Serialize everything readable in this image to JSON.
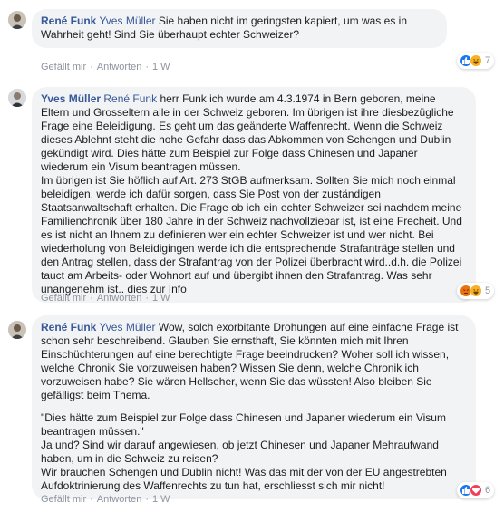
{
  "comments": [
    {
      "author": "René Funk",
      "mention": "Yves Müller",
      "paragraphs": [
        "Sie haben nicht im geringsten kapiert, um was es in Wahrheit geht! Sind Sie überhaupt echter Schweizer?"
      ],
      "actions": {
        "like": "Gefällt mir",
        "reply": "Antworten",
        "time": "1 W"
      },
      "reactions": {
        "icons": [
          "like",
          "haha"
        ],
        "count": "7"
      }
    },
    {
      "author": "Yves Müller",
      "mention": "René Funk",
      "paragraphs": [
        "herr Funk ich wurde am 4.3.1974 in Bern geboren, meine Eltern und Grosseltern alle in der Schweiz geboren. Im übrigen ist ihre diesbezügliche Frage eine Beleidigung. Es geht um das geänderte Waffenrecht. Wenn die Schweiz dieses Ablehnt steht die hohe Gefahr dass das Abkommen von Schengen und Dublin gekündigt wird. Dies hätte zum Beispiel zur Folge dass Chinesen und Japaner wiederum ein Visum beantragen müssen.\nIm übrigen ist Sie höflich auf Art. 273 StGB aufmerksam. Sollten Sie mich noch einmal beleidigen, werde ich dafür sorgen, dass Sie Post von der zuständigen Staatsanwaltschaft erhalten. Die Frage ob ich ein echter Schweizer sei nachdem meine Familienchronik über 180 Jahre in der Schweiz nachvollziebar ist, ist eine Frecheit. Und es ist nicht an Ihnem zu definieren wer ein echter Schweizer ist und wer nicht. Bei wiederholung von Beleidigingen werde ich die entsprechende Strafanträge stellen und den Antrag stellen, dass der Strafantrag von der Polizei überbracht wird..d.h. die Polizei tauct am Arbeits- oder Wohnort auf und übergibt ihnen den Strafantrag. Was sehr unangenehm ist.. dies zur Info"
      ],
      "actions": {
        "like": "Gefällt mir",
        "reply": "Antworten",
        "time": "1 W"
      },
      "reactions": {
        "icons": [
          "angry",
          "haha"
        ],
        "count": "5"
      }
    },
    {
      "author": "René Funk",
      "mention": "Yves Müller",
      "paragraphs": [
        "Wow, solch exorbitante Drohungen auf eine einfache Frage ist schon sehr beschreibend. Glauben Sie ernsthaft, Sie könnten mich mit Ihren Einschüchterungen auf eine berechtigte Frage beeindrucken? Woher soll ich wissen, welche Chronik Sie vorzuweisen haben? Wissen Sie denn, welche Chronik ich vorzuweisen habe? Sie wären Hellseher, wenn Sie das wüssten! Also bleiben Sie gefälligst beim Thema.",
        "\"Dies hätte zum Beispiel zur Folge dass Chinesen und Japaner wiederum ein Visum beantragen müssen.\"\nJa und? Sind wir darauf angewiesen, ob jetzt Chinesen und Japaner Mehraufwand haben, um in die Schweiz zu reisen?\nWir brauchen Schengen und Dublin nicht! Was das mit der von der EU angestrebten Aufdoktrinierung des Waffenrechts zu tun hat, erschliesst sich mir nicht!"
      ],
      "actions": {
        "like": "Gefällt mir",
        "reply": "Antworten",
        "time": "1 W"
      },
      "reactions": {
        "icons": [
          "like",
          "love"
        ],
        "count": "6"
      }
    }
  ],
  "colors": {
    "like": "#1877f2",
    "love": "#f33e58",
    "haha": "#f7b125",
    "angry": "#e9710f",
    "name": "#385898"
  }
}
